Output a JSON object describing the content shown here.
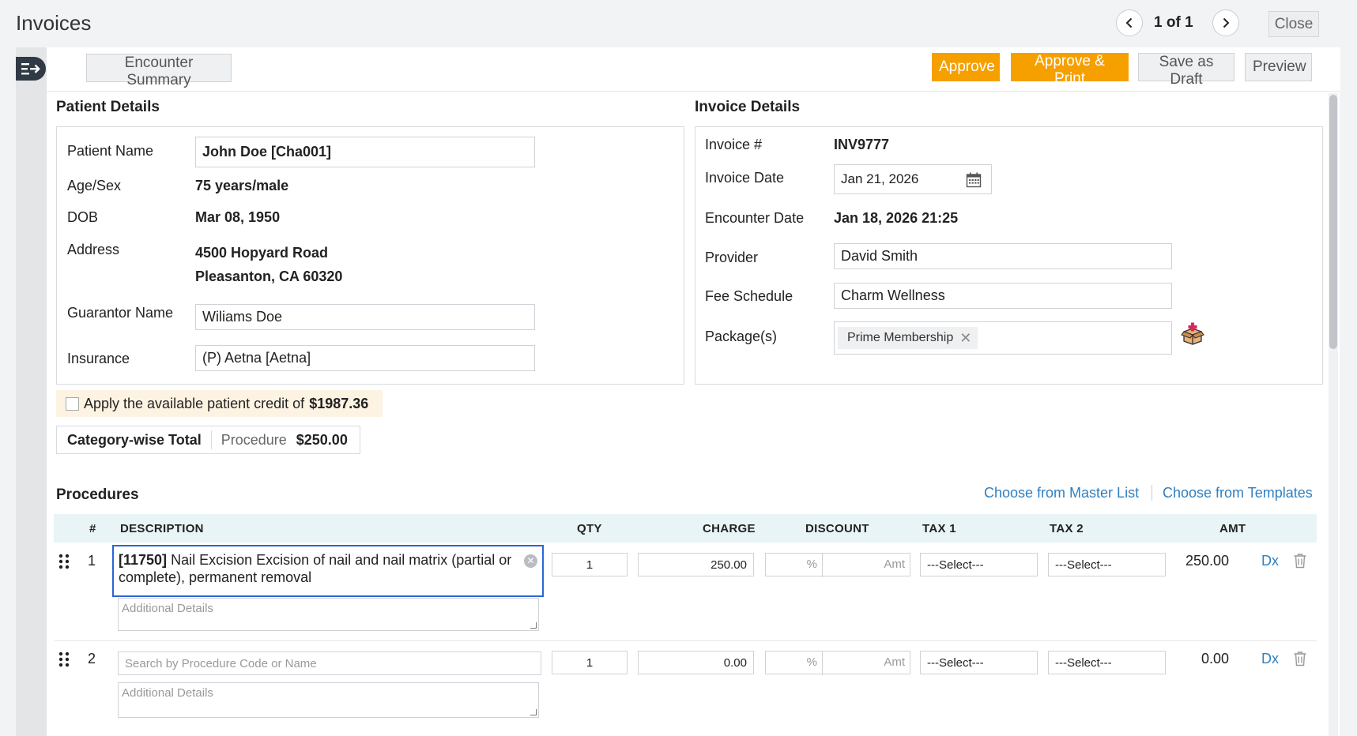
{
  "header": {
    "title": "Invoices",
    "pager": {
      "current": "1",
      "of_label": "of",
      "total": "1"
    },
    "close_label": "Close"
  },
  "toolbar": {
    "encounter_summary": "Encounter Summary",
    "approve": "Approve",
    "approve_print": "Approve & Print",
    "save_draft": "Save as Draft",
    "preview": "Preview"
  },
  "patient": {
    "section_title": "Patient Details",
    "name_label": "Patient Name",
    "name_value": "John Doe [Cha001]",
    "age_label": "Age/Sex",
    "age_value": "75 years/male",
    "dob_label": "DOB",
    "dob_value": "Mar 08, 1950",
    "address_label": "Address",
    "address_line1": "4500 Hopyard Road",
    "address_line2": "Pleasanton, CA 60320",
    "guarantor_label": "Guarantor Name",
    "guarantor_value": "Wiliams Doe",
    "insurance_label": "Insurance",
    "insurance_value": "(P) Aetna [Aetna]"
  },
  "invoice": {
    "section_title": "Invoice Details",
    "number_label": "Invoice #",
    "number_value": "INV9777",
    "date_label": "Invoice Date",
    "date_value": "Jan 21, 2026",
    "encounter_label": "Encounter Date",
    "encounter_value": "Jan 18, 2026 21:25",
    "provider_label": "Provider",
    "provider_value": "David Smith",
    "fee_label": "Fee Schedule",
    "fee_value": "Charm Wellness",
    "package_label": "Package(s)",
    "package_tag": "Prime Membership"
  },
  "credit": {
    "text": "Apply the available patient credit of",
    "amount": "$1987.36"
  },
  "category_total": {
    "label": "Category-wise Total",
    "category": "Procedure",
    "amount": "$250.00"
  },
  "procedures": {
    "section_title": "Procedures",
    "master_link": "Choose from Master List",
    "templates_link": "Choose from Templates",
    "columns": {
      "num": "#",
      "description": "DESCRIPTION",
      "qty": "QTY",
      "charge": "CHARGE",
      "discount": "DISCOUNT",
      "tax1": "TAX 1",
      "tax2": "TAX 2",
      "amt": "AMT"
    },
    "rows": [
      {
        "num": "1",
        "code": "[11750]",
        "desc": "Nail Excision Excision of nail and nail matrix (partial or complete), permanent removal",
        "details_placeholder": "Additional Details",
        "qty": "1",
        "charge": "250.00",
        "pct": "%",
        "amt_placeholder": "Amt",
        "tax1": "---Select---",
        "tax2": "---Select---",
        "amt": "250.00",
        "dx": "Dx"
      },
      {
        "num": "2",
        "search_placeholder": "Search by Procedure Code or Name",
        "details_placeholder": "Additional Details",
        "qty": "1",
        "charge": "0.00",
        "pct": "%",
        "amt_placeholder": "Amt",
        "tax1": "---Select---",
        "tax2": "---Select---",
        "amt": "0.00",
        "dx": "Dx"
      }
    ]
  },
  "icons": {
    "prev": "chevron-left-icon",
    "next": "chevron-right-icon",
    "calendar": "calendar-icon",
    "package": "package-add-icon",
    "drag": "drag-handle-icon",
    "trash": "trash-icon"
  },
  "colors": {
    "accent_orange": "#f6a000",
    "link_blue": "#2f7fc1",
    "focus_blue": "#2a66d6",
    "header_tint": "#e8f4f6"
  }
}
